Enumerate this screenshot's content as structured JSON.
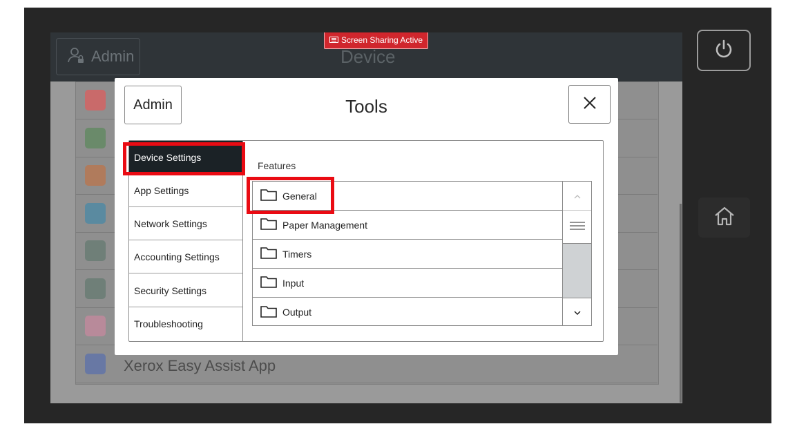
{
  "background_header": {
    "admin_label": "Admin",
    "title": "Device",
    "screen_sharing_badge": "Screen Sharing Active"
  },
  "background_list": {
    "rows": [
      {
        "icon": "photo-upload-icon",
        "color": "#c96a6a"
      },
      {
        "icon": "list-icon",
        "color": "#6a8a6a"
      },
      {
        "icon": "box-icon",
        "color": "#b07b5c"
      },
      {
        "icon": "calculator-icon",
        "color": "#5a8aa0"
      },
      {
        "icon": "device-icon",
        "color": "#6f7f78"
      },
      {
        "icon": "device-icon",
        "color": "#6f7f78"
      },
      {
        "icon": "cloud-upload-icon",
        "color": "#b88a9a"
      },
      {
        "icon": "id-badge-icon",
        "color": "#6878a4"
      }
    ],
    "last_row_label": "Xerox Easy Assist App"
  },
  "side_buttons": {
    "power": "power-icon",
    "home": "home-icon"
  },
  "modal": {
    "admin_label": "Admin",
    "title": "Tools",
    "close": "close-icon",
    "nav": [
      {
        "label": "Device Settings",
        "active": true
      },
      {
        "label": "App Settings",
        "active": false
      },
      {
        "label": "Network Settings",
        "active": false
      },
      {
        "label": "Accounting Settings",
        "active": false
      },
      {
        "label": "Security Settings",
        "active": false
      },
      {
        "label": "Troubleshooting",
        "active": false
      }
    ],
    "features_label": "Features",
    "features": [
      {
        "label": "General",
        "icon": "folder-icon"
      },
      {
        "label": "Paper Management",
        "icon": "folder-icon"
      },
      {
        "label": "Timers",
        "icon": "folder-icon"
      },
      {
        "label": "Input",
        "icon": "folder-icon"
      },
      {
        "label": "Output",
        "icon": "folder-icon"
      }
    ]
  },
  "colors": {
    "highlight": "#ea0b13",
    "active_nav": "#1b2226",
    "badge": "#d0262d"
  }
}
